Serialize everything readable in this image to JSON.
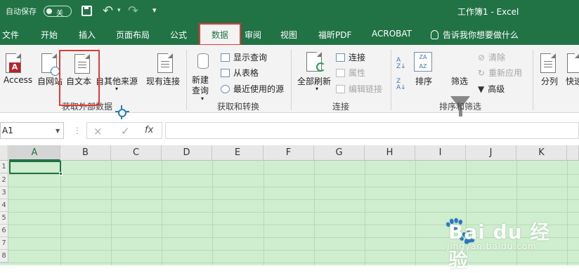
{
  "title_bar": {
    "autosave_label": "自动保存",
    "autosave_state": "关",
    "document_title": "工作簿1 - Excel"
  },
  "ribbon_tabs": [
    "文件",
    "开始",
    "插入",
    "页面布局",
    "公式",
    "数据",
    "审阅",
    "视图",
    "福昕PDF",
    "ACROBAT"
  ],
  "active_tab": "数据",
  "tell_me": "告诉我你想要做什么",
  "groups": {
    "external": {
      "label": "获取外部数据",
      "buttons": [
        "Access",
        "自网站",
        "自文本",
        "自其他来源",
        "现有连接"
      ]
    },
    "transform": {
      "label": "获取和转换",
      "new_query": "新建\n查询",
      "items": [
        "显示查询",
        "从表格",
        "最近使用的源"
      ]
    },
    "connections": {
      "label": "连接",
      "refresh_all": "全部刷新",
      "items": [
        "连接",
        "属性",
        "编辑链接"
      ]
    },
    "sort_filter": {
      "label": "排序和筛选",
      "sort": "排序",
      "filter": "筛选",
      "items": [
        "清除",
        "重新应用",
        "高级"
      ]
    },
    "data_tools": {
      "buttons": [
        "分列",
        "快速"
      ]
    }
  },
  "formula_bar": {
    "name_box": "A1",
    "fx": "fx",
    "content": ""
  },
  "sheet": {
    "columns": [
      "A",
      "B",
      "C",
      "D",
      "E",
      "F",
      "G",
      "H",
      "I",
      "J",
      "K"
    ],
    "rows": [
      "1",
      "2",
      "3",
      "4",
      "5",
      "6",
      "7",
      "8"
    ]
  },
  "watermark": {
    "brand": "Bai du 经验",
    "url": "jingyan.baidu.com"
  },
  "colors": {
    "excel_green": "#217346",
    "highlight_red": "#e03b35",
    "sheet_green": "#cfeecf"
  }
}
